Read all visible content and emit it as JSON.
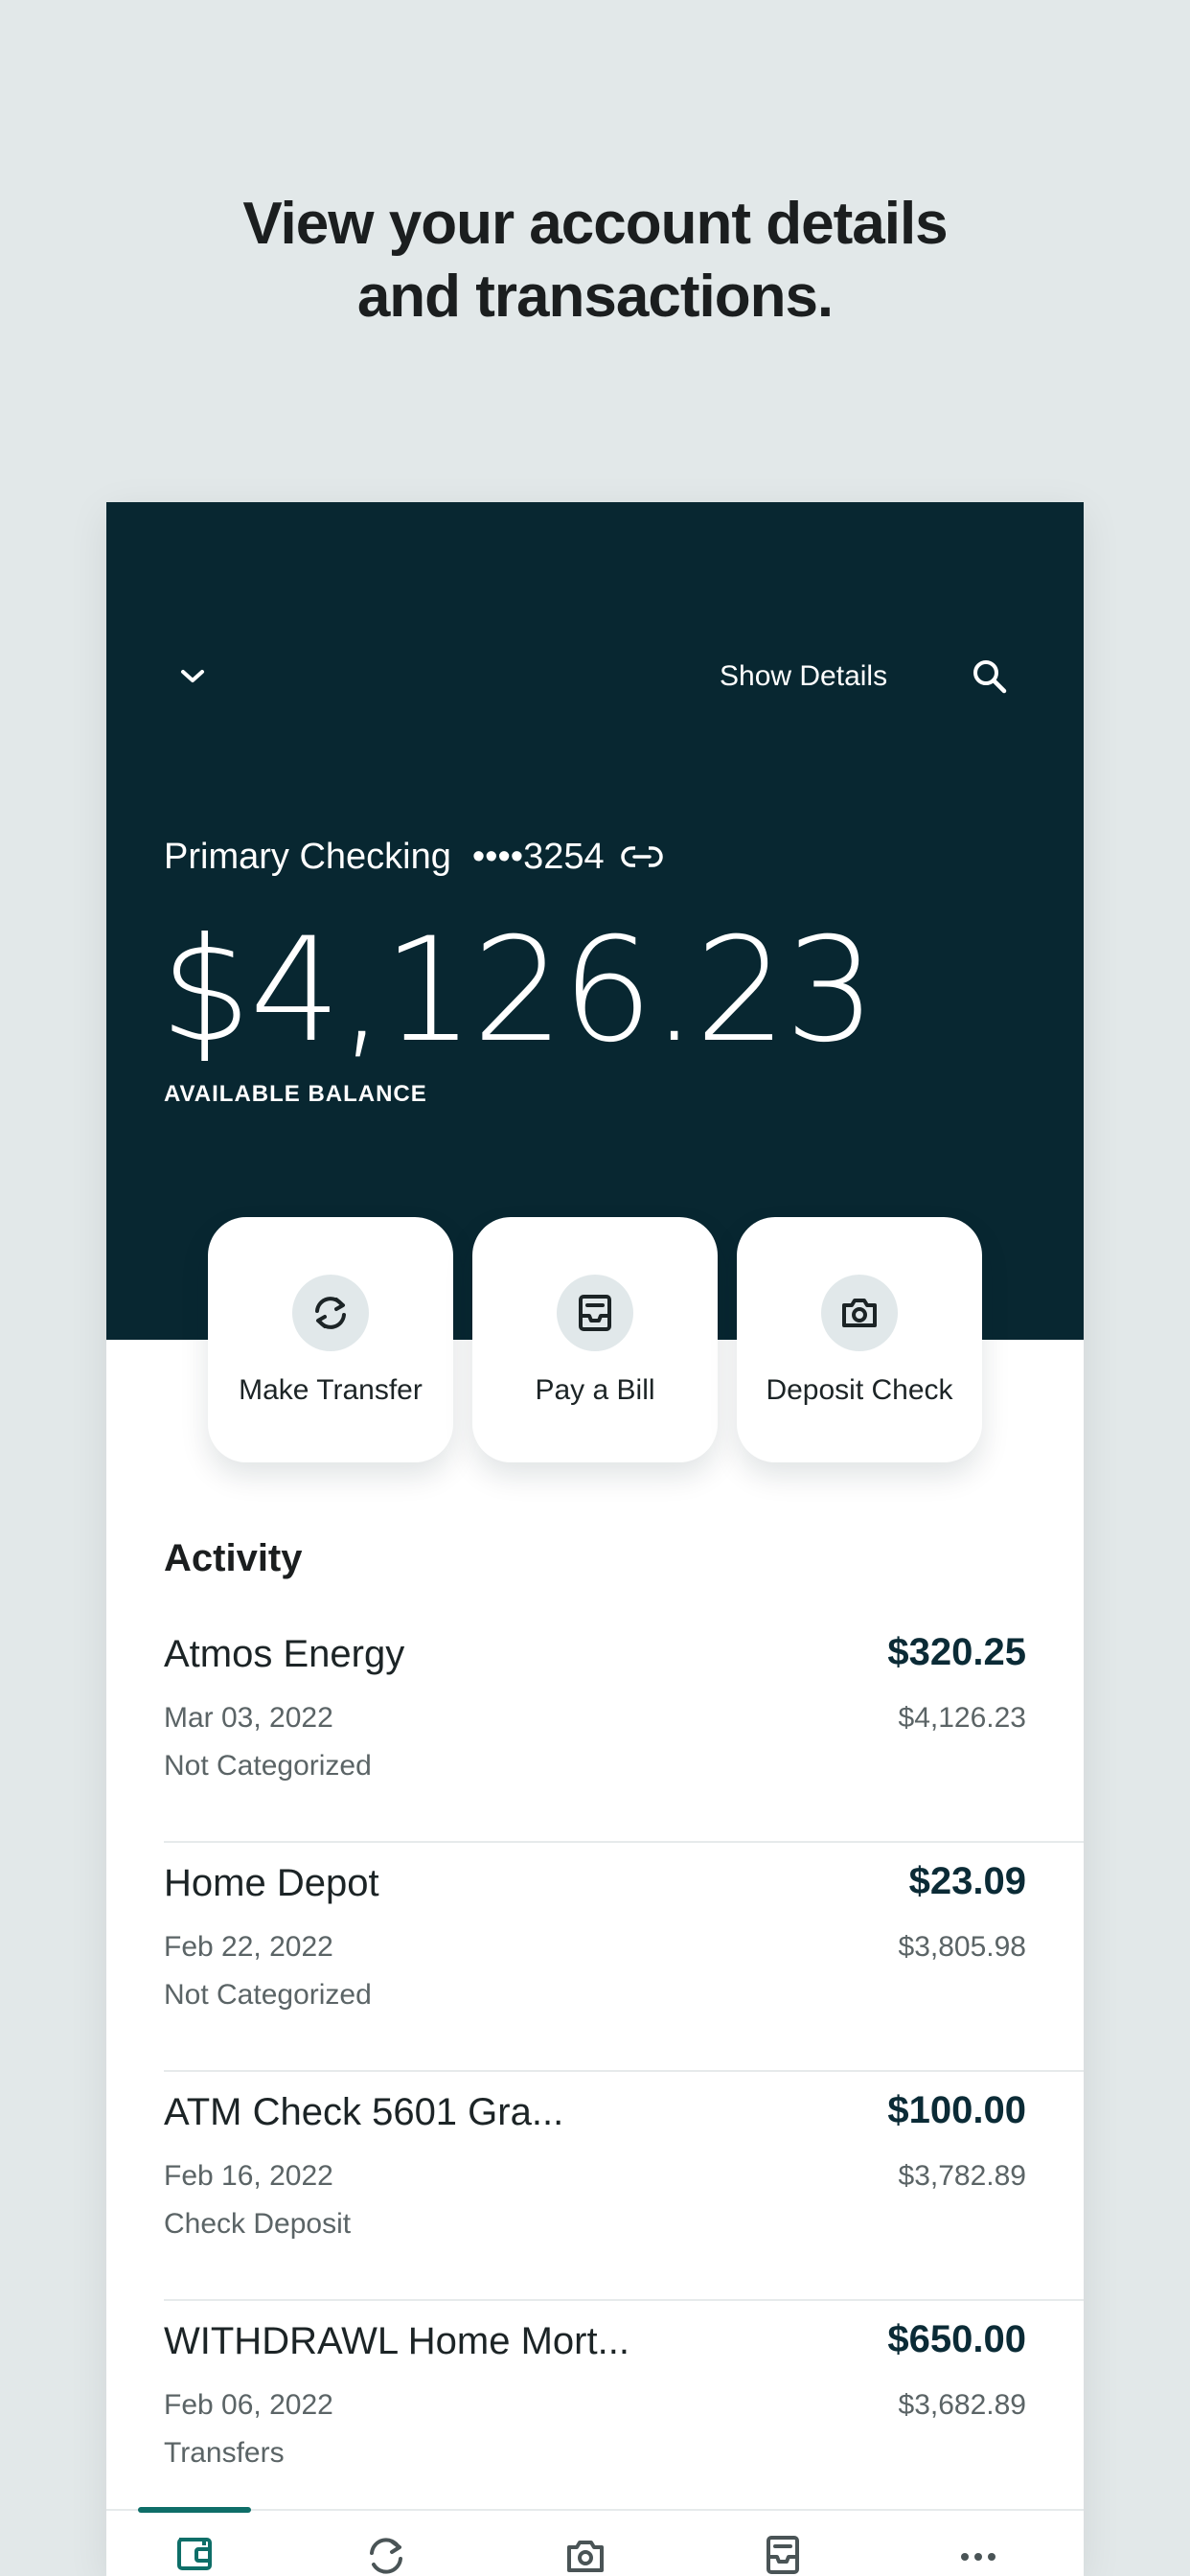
{
  "headline": {
    "line1": "View your account details",
    "line2": "and transactions."
  },
  "header": {
    "show_details_label": "Show Details"
  },
  "account": {
    "name": "Primary Checking",
    "mask": "••••3254",
    "balance": "$4,126.23",
    "balance_label": "AVAILABLE BALANCE"
  },
  "actions": [
    {
      "label": "Make Transfer",
      "icon": "transfer-icon"
    },
    {
      "label": "Pay a Bill",
      "icon": "bill-icon"
    },
    {
      "label": "Deposit Check",
      "icon": "camera-icon"
    }
  ],
  "activity": {
    "title": "Activity",
    "transactions": [
      {
        "name": "Atmos Energy",
        "date": "Mar 03, 2022",
        "category": "Not Categorized",
        "amount": "$320.25",
        "balance": "$4,126.23"
      },
      {
        "name": "Home Depot",
        "date": "Feb 22, 2022",
        "category": "Not Categorized",
        "amount": "$23.09",
        "balance": "$3,805.98"
      },
      {
        "name": "ATM Check 5601 Gra...",
        "date": "Feb 16, 2022",
        "category": "Check Deposit",
        "amount": "$100.00",
        "balance": "$3,782.89"
      },
      {
        "name": "WITHDRAWL Home Mort...",
        "date": "Feb 06, 2022",
        "category": "Transfers",
        "amount": "$650.00",
        "balance": "$3,682.89"
      }
    ]
  },
  "tabbar": {
    "tabs": [
      "wallet-icon",
      "transfer-icon",
      "camera-icon",
      "bill-icon",
      "more-icon"
    ],
    "active_index": 0
  },
  "colors": {
    "hero": "#082731",
    "background": "#e2e8e9",
    "accent": "#0e6e68",
    "amount": "#0b2b36"
  }
}
